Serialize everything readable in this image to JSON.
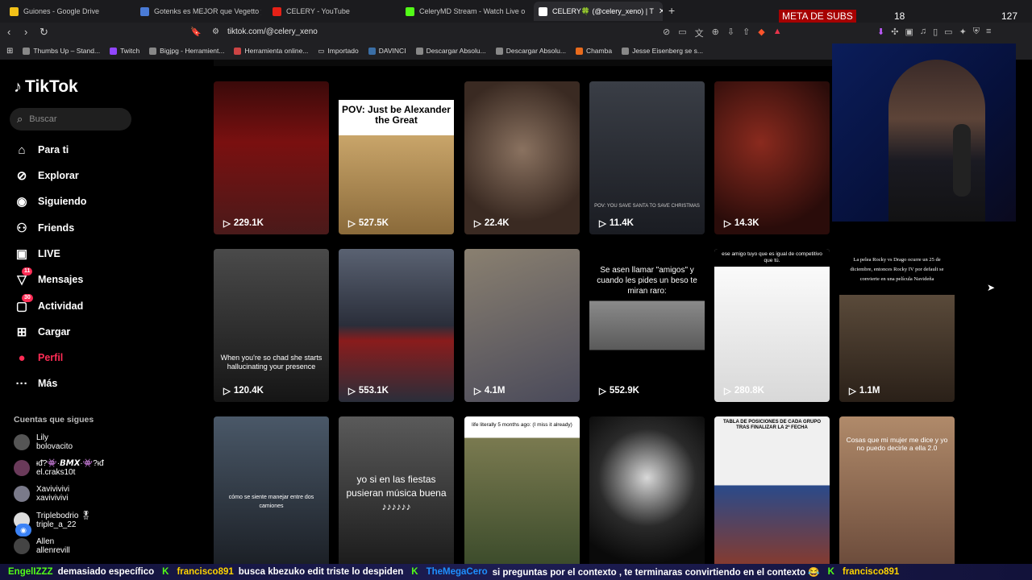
{
  "browser": {
    "tabs": [
      {
        "title": "Guiones - Google Drive",
        "color": "#f2c118"
      },
      {
        "title": "Gotenks es MEJOR que Vegetto y Go",
        "color": "#4a7bd6"
      },
      {
        "title": "CELERY - YouTube",
        "color": "#e62117"
      },
      {
        "title": "CeleryMD Stream - Watch Live on Kic",
        "color": "#53fc18"
      },
      {
        "title": "CELERY🍀 (@celery_xeno) | T",
        "color": "#ffffff"
      }
    ],
    "new_tab": "+",
    "url": "tiktok.com/@celery_xeno",
    "bookmarks": [
      "Thumbs Up – Stand...",
      "Twitch",
      "Bigjpg - Herramient...",
      "Herramienta online...",
      "Importado",
      "DAVINCI",
      "Descargar Absolu...",
      "Descargar Absolu...",
      "Chamba",
      "Jesse Eisenberg se s..."
    ]
  },
  "overlay": {
    "meta_label": "META DE SUBS",
    "meta_current": "18",
    "meta_goal": "127"
  },
  "tiktok": {
    "logo": "TikTok",
    "search_placeholder": "Buscar",
    "nav": [
      {
        "label": "Para ti",
        "icon": "home-icon",
        "glyph": "⌂"
      },
      {
        "label": "Explorar",
        "icon": "compass-icon",
        "glyph": "⊘"
      },
      {
        "label": "Siguiendo",
        "icon": "following-avatar-icon",
        "glyph": "◉"
      },
      {
        "label": "Friends",
        "icon": "friends-icon",
        "glyph": "⚇"
      },
      {
        "label": "LIVE",
        "icon": "live-icon",
        "glyph": "▣"
      },
      {
        "label": "Mensajes",
        "icon": "messages-icon",
        "glyph": "▽",
        "badge": "11"
      },
      {
        "label": "Actividad",
        "icon": "activity-icon",
        "glyph": "▢",
        "badge": "30"
      },
      {
        "label": "Cargar",
        "icon": "upload-icon",
        "glyph": "⊞"
      },
      {
        "label": "Perfil",
        "icon": "profile-icon",
        "glyph": "●"
      },
      {
        "label": "Más",
        "icon": "more-icon",
        "glyph": "···"
      }
    ],
    "following_title": "Cuentas que sigues",
    "following": [
      {
        "name": "Lily",
        "handle": "bolovacito"
      },
      {
        "name": "ᵻᵭ?👾·𝘽𝙈𝙓·👾?ᵻᵭ",
        "handle": "el.craks10t"
      },
      {
        "name": "Xavivivivi",
        "handle": "xavivivivi"
      },
      {
        "name": "Triplebodrio 🎖",
        "handle": "triple_a_22"
      },
      {
        "name": "Allen",
        "handle": "allenrevill"
      }
    ],
    "videos_row1": [
      {
        "views": "229.1K",
        "bg": "#7a1010"
      },
      {
        "views": "527.5K",
        "bg": "#c9a56a",
        "caption": "POV: Just be Alexander the Great"
      },
      {
        "views": "22.4K",
        "bg": "#5b4a3a"
      },
      {
        "views": "11.4K",
        "bg": "#2a2e36",
        "caption": "POV: YOU SAVE SANTA TO SAVE CHRISTMAS"
      },
      {
        "views": "14.3K",
        "bg": "#4a1a16"
      }
    ],
    "videos_row2": [
      {
        "views": "120.4K",
        "bg": "#2a2a2a",
        "caption": "When you're so chad she starts hallucinating your presence"
      },
      {
        "views": "553.1K",
        "bg": "#3c4452"
      },
      {
        "views": "4.1M",
        "bg": "#6a6050"
      },
      {
        "views": "552.9K",
        "bg": "#000000",
        "caption": "Se asen llamar \"amigos\" y cuando les pides un beso te miran raro:"
      },
      {
        "views": "280.8K",
        "bg": "#e8e8e8",
        "caption": "ese amigo tuyo que es igual de competitivo que tú."
      },
      {
        "views": "1.1M",
        "bg": "#1e1a16",
        "caption": "La pelea Rocky vs Drago ocurre un 25 de diciembre, entonces Rocky IV por default se convierte en una película Navideña"
      }
    ],
    "videos_row3": [
      {
        "bg": "#2a3340",
        "caption": "cómo se siente manejar entre dos camiones"
      },
      {
        "bg": "#3a3a3a",
        "caption": "yo si en las fiestas pusieran música buena ♪♪♪♪♪♪"
      },
      {
        "bg": "#5a5a3a",
        "caption": "life literally 5 months ago: (I miss it already)"
      },
      {
        "bg": "#1a1a1a"
      },
      {
        "bg": "#e0e0e0",
        "caption": "TABLA DE POSICIONES DE CADA GRUPO TRAS FINALIZAR LA 2ª FECHA"
      },
      {
        "bg": "#8a6a50",
        "caption": "Cosas que mi mujer me dice y yo no puedo decirle a ella 2.0"
      }
    ]
  },
  "chat": [
    {
      "user": "EngelIZZZ",
      "color": "#53fc18",
      "msg": "demasiado específico"
    },
    {
      "user": "francisco891",
      "color": "#ffd400",
      "msg": "busca kbezuko edit triste lo despiden"
    },
    {
      "user": "TheMegaCero",
      "color": "#1e90ff",
      "msg": "si preguntas por el contexto , te terminaras convirtiendo en el contexto 😂"
    },
    {
      "user": "francisco891",
      "color": "#ffd400",
      "msg": ""
    }
  ]
}
